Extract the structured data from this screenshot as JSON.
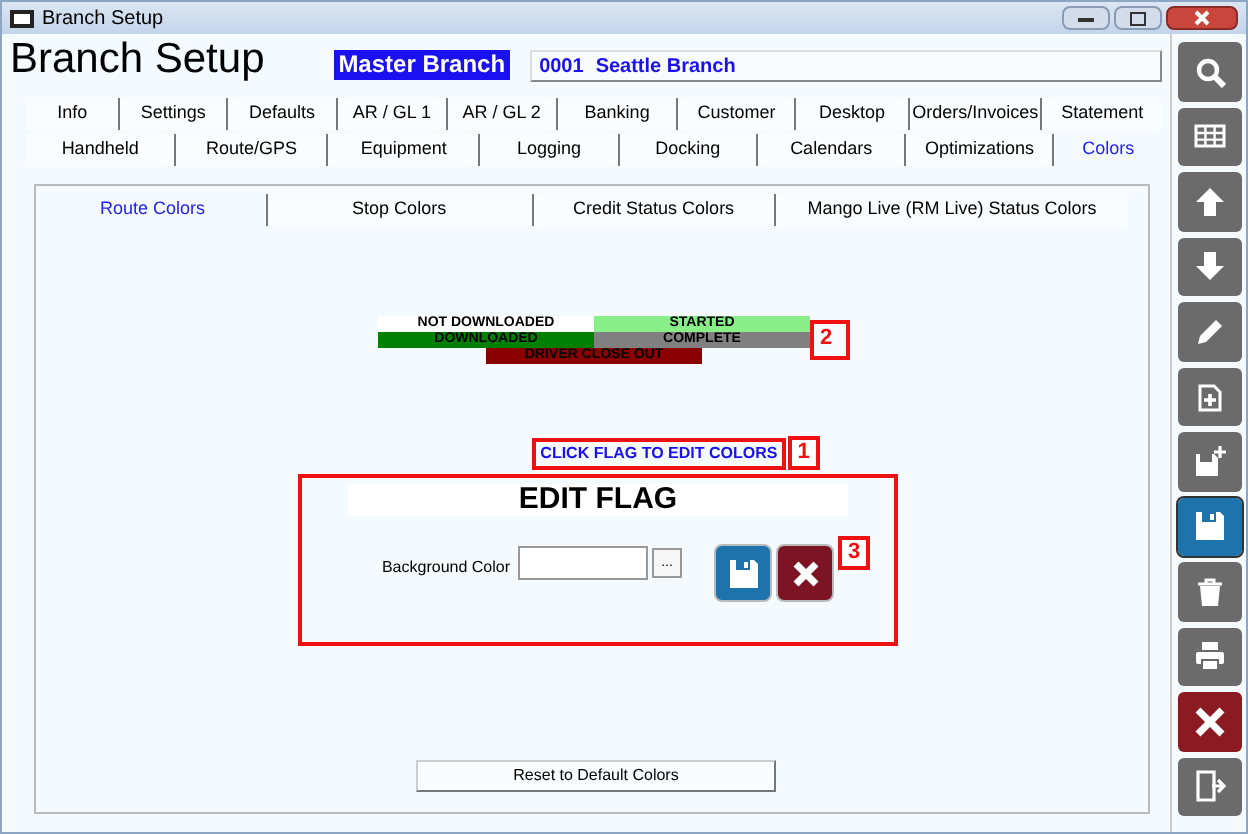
{
  "window": {
    "title": "Branch Setup"
  },
  "header": {
    "title": "Branch Setup",
    "badge": "Master Branch",
    "branch_code": "0001",
    "branch_name": "Seattle Branch"
  },
  "tabs_row_1": [
    {
      "label": "Info",
      "selected": false
    },
    {
      "label": "Settings",
      "selected": false
    },
    {
      "label": "Defaults",
      "selected": false
    },
    {
      "label": "AR / GL 1",
      "selected": false
    },
    {
      "label": "AR / GL 2",
      "selected": false
    },
    {
      "label": "Banking",
      "selected": false
    },
    {
      "label": "Customer",
      "selected": false
    },
    {
      "label": "Desktop",
      "selected": false
    },
    {
      "label": "Orders/Invoices",
      "selected": false
    },
    {
      "label": "Statement",
      "selected": false
    }
  ],
  "tabs_row_2": [
    {
      "label": "Handheld",
      "selected": false
    },
    {
      "label": "Route/GPS",
      "selected": false
    },
    {
      "label": "Equipment",
      "selected": false
    },
    {
      "label": "Logging",
      "selected": false
    },
    {
      "label": "Docking",
      "selected": false
    },
    {
      "label": "Calendars",
      "selected": false
    },
    {
      "label": "Optimizations",
      "selected": false
    },
    {
      "label": "Colors",
      "selected": true
    }
  ],
  "sub_tabs": [
    {
      "label": "Route Colors",
      "selected": true
    },
    {
      "label": "Stop Colors",
      "selected": false
    },
    {
      "label": "Credit Status Colors",
      "selected": false
    },
    {
      "label": "Mango Live (RM Live) Status Colors",
      "selected": false
    }
  ],
  "flags": [
    {
      "label": "NOT DOWNLOADED",
      "color": "#ffffff"
    },
    {
      "label": "STARTED",
      "color": "#88ee88"
    },
    {
      "label": "DOWNLOADED",
      "color": "#008000"
    },
    {
      "label": "COMPLETE",
      "color": "#808080"
    },
    {
      "label": "DRIVER CLOSE OUT",
      "color": "#8b0000"
    }
  ],
  "hint": "CLICK FLAG TO EDIT COLORS",
  "edit_flag": {
    "title": "EDIT FLAG",
    "field_label": "Background Color",
    "browse": "..."
  },
  "reset_button": "Reset to Default Colors",
  "callouts": [
    {
      "label": "1"
    },
    {
      "label": "2"
    },
    {
      "label": "3"
    }
  ],
  "toolbar": [
    {
      "kind": "search"
    },
    {
      "kind": "grid"
    },
    {
      "kind": "up"
    },
    {
      "kind": "down"
    },
    {
      "kind": "edit"
    },
    {
      "kind": "new"
    },
    {
      "kind": "save-new"
    },
    {
      "kind": "save"
    },
    {
      "kind": "delete"
    },
    {
      "kind": "print"
    },
    {
      "kind": "close"
    },
    {
      "kind": "exit"
    }
  ]
}
